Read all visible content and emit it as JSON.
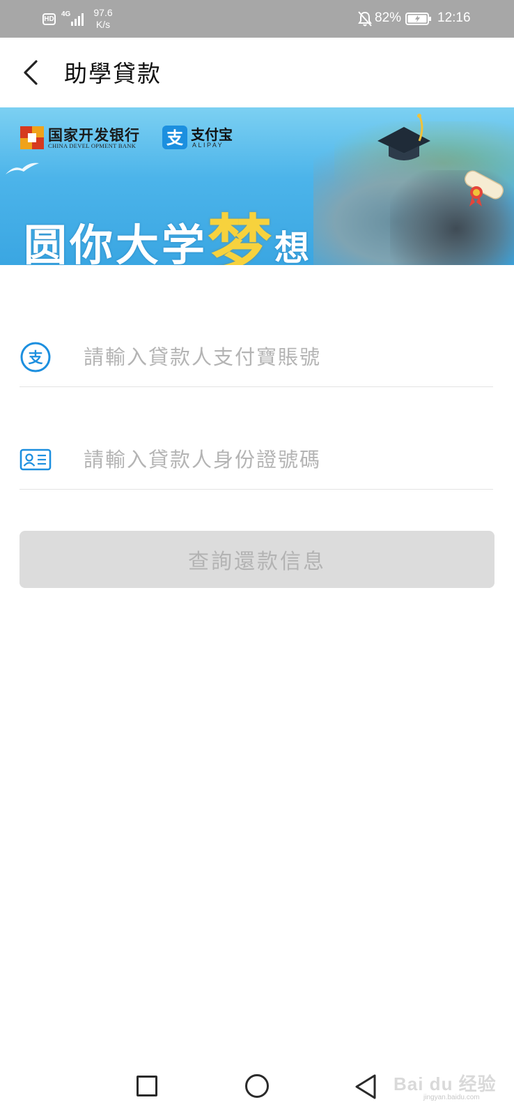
{
  "status_bar": {
    "hd": "HD",
    "network": "4G",
    "speed_value": "97.6",
    "speed_unit": "K/s",
    "battery": "82%",
    "time": "12:16"
  },
  "header": {
    "title": "助學貸款"
  },
  "banner": {
    "bank_name": "国家开发银行",
    "bank_name_en": "CHINA DEVEL OPMENT BANK",
    "alipay_name": "支付宝",
    "alipay_en": "ALIPAY",
    "slogan_part1": "圆你大学",
    "slogan_dream": "梦",
    "slogan_part2": "想"
  },
  "form": {
    "account_placeholder": "請輸入貸款人支付寶賬號",
    "id_placeholder": "請輸入貸款人身份證號碼",
    "submit_label": "查詢還款信息"
  },
  "watermark": {
    "text": "Bai du 经验",
    "url": "jingyan.baidu.com"
  },
  "colors": {
    "accent": "#1c8fdf",
    "button_disabled": "#dcdcdc",
    "status_bar": "#a7a7a7"
  }
}
